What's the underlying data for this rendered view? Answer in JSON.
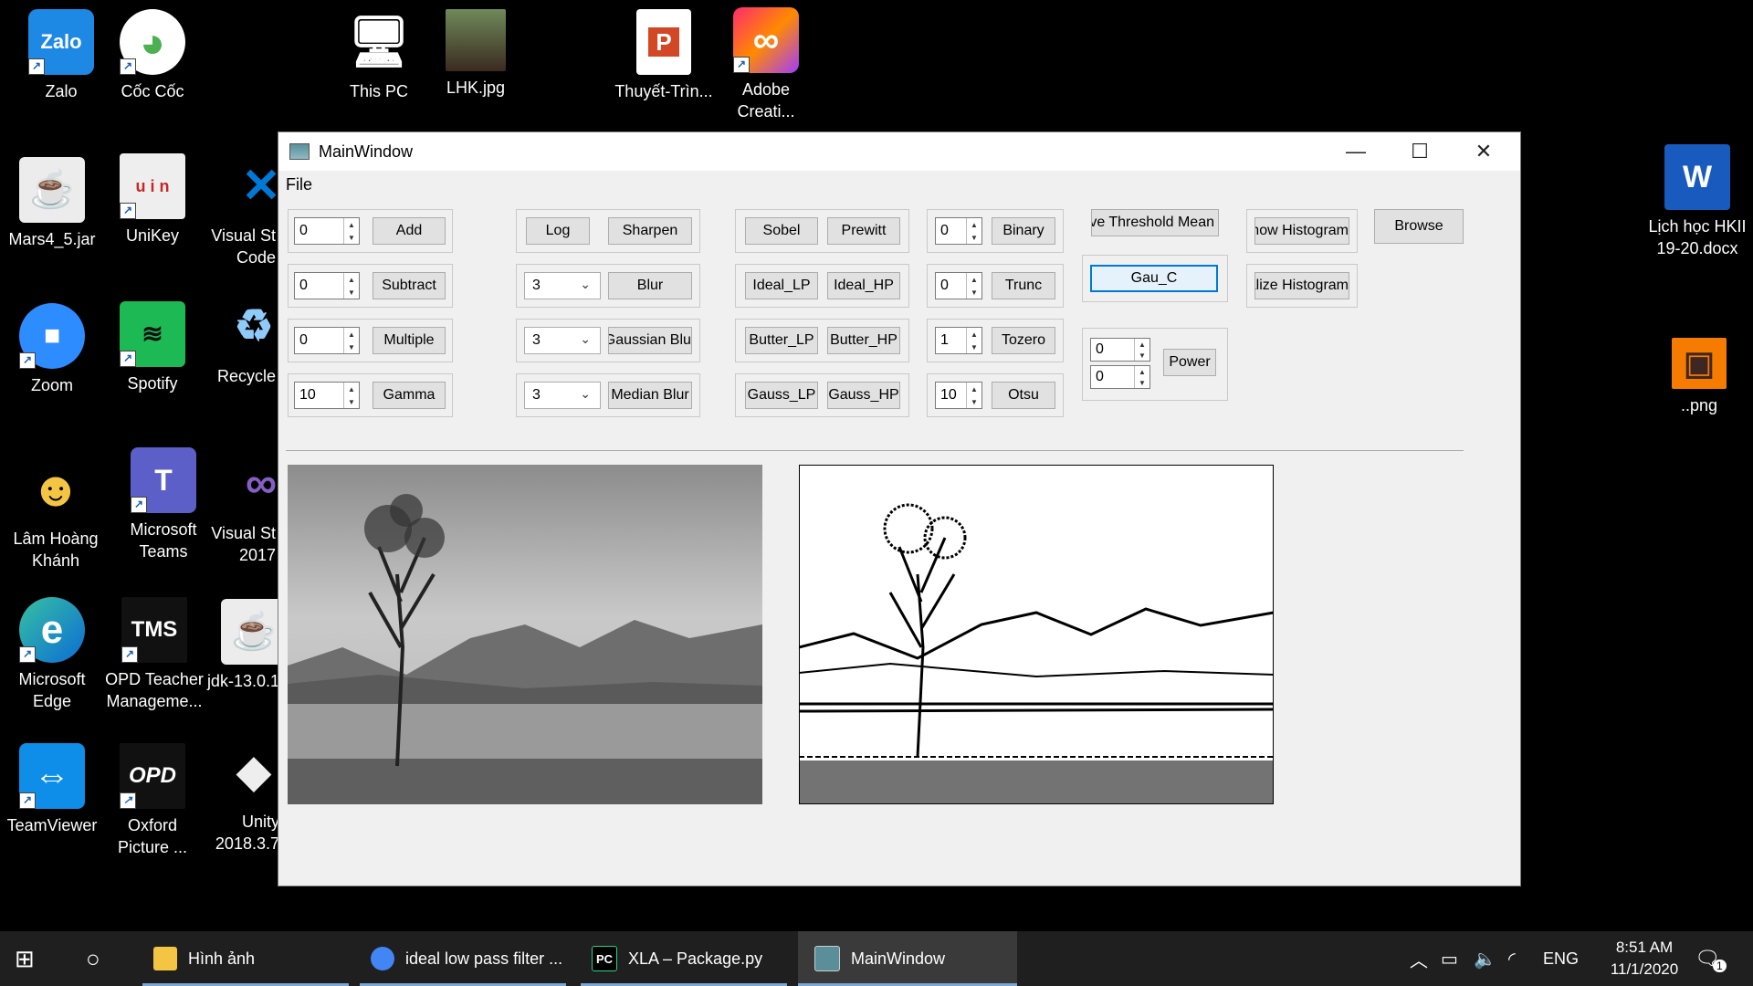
{
  "desktop_icons": [
    {
      "label": "Zalo",
      "glyph": "Zalo",
      "color": "#1e88e5"
    },
    {
      "label": "Cốc Cốc",
      "glyph": "◕",
      "color": "#4caf50"
    },
    {
      "label": "This PC",
      "glyph": "🖥",
      "color": "#2196f3"
    },
    {
      "label": "LHK.jpg",
      "glyph": "",
      "color": "#7a6a55"
    },
    {
      "label": "Thuyết-Trìn...",
      "glyph": "P",
      "color": "#d24726"
    },
    {
      "label": "Adobe Creati...",
      "glyph": "∞",
      "color": "#e53935"
    },
    {
      "label": "Mars4_5.jar",
      "glyph": "☕",
      "color": "#e8e8e8"
    },
    {
      "label": "UniKey",
      "glyph": "u i n",
      "color": "#eeeeee"
    },
    {
      "label": "Visual St Code",
      "glyph": "✕",
      "color": "#0078d7"
    },
    {
      "label": "Lịch học  HKII 19-20.docx",
      "glyph": "W",
      "color": "#185abd"
    },
    {
      "label": "Zoom",
      "glyph": "■",
      "color": "#2d8cff"
    },
    {
      "label": "Spotify",
      "glyph": "≋",
      "color": "#1db954"
    },
    {
      "label": "Recycle",
      "glyph": "♻",
      "color": "#cfd8dc"
    },
    {
      "label": "..png",
      "glyph": "▣",
      "color": "#f57c00"
    },
    {
      "label": "Lâm Hoàng Khánh",
      "glyph": "☻",
      "color": "#f4c542"
    },
    {
      "label": "Microsoft Teams",
      "glyph": "T",
      "color": "#5b5fc7"
    },
    {
      "label": "Visual St 2017",
      "glyph": "∞",
      "color": "#865fc5"
    },
    {
      "label": "Microsoft Edge",
      "glyph": "e",
      "color": "#0c8ad6"
    },
    {
      "label": "OPD Teacher Manageme...",
      "glyph": "TMS",
      "color": "#111111"
    },
    {
      "label": "jdk-13.0.1",
      "glyph": "☕",
      "color": "#e8e8e8"
    },
    {
      "label": "TeamViewer",
      "glyph": "⇔",
      "color": "#0e8ee9"
    },
    {
      "label": "Oxford Picture ...",
      "glyph": "OPD",
      "color": "#111111"
    },
    {
      "label": "Unity 2018.3.7",
      "glyph": "◆",
      "color": "#222222"
    }
  ],
  "window": {
    "title": "MainWindow",
    "menu": [
      "File"
    ],
    "spinboxes": [
      "0",
      "0",
      "0",
      "10",
      "0",
      "0",
      "1",
      "10",
      "0",
      "0"
    ],
    "combos": [
      "3",
      "3",
      "3"
    ],
    "buttons": {
      "add": "Add",
      "subtract": "Subtract",
      "multiple": "Multiple",
      "gamma": "Gamma",
      "log": "Log",
      "sharpen": "Sharpen",
      "blur": "Blur",
      "gaussian_blur": "Gaussian Blur",
      "median_blur": "Median Blur",
      "sobel": "Sobel",
      "prewitt": "Prewitt",
      "ideal_lp": "Ideal_LP",
      "ideal_hp": "Ideal_HP",
      "butter_lp": "Butter_LP",
      "butter_hp": "Butter_HP",
      "gauss_lp": "Gauss_LP",
      "gauss_hp": "Gauss_HP",
      "binary": "Binary",
      "trunc": "Trunc",
      "tozero": "Tozero",
      "otsu": "Otsu",
      "adaptive_threshold": "Adaptive Threshold Mean",
      "gau_c": "Gau_C",
      "power": "Power",
      "show_histogram": "Show Histogram",
      "equalize_histogram": "Equalize Histogram",
      "browse": "Browse"
    }
  },
  "taskbar": {
    "items": [
      "Hình ảnh",
      "ideal low pass filter ...",
      "XLA – Package.py",
      "MainWindow"
    ],
    "lang": "ENG",
    "time": "8:51 AM",
    "date": "11/1/2020",
    "notif_count": "1"
  }
}
